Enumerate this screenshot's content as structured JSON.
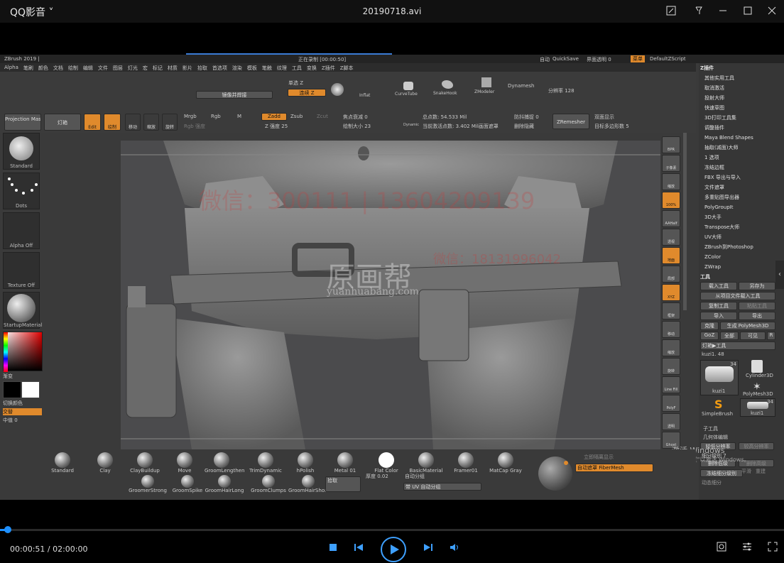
{
  "player": {
    "app_name": "QQ影音",
    "chevron": "˅",
    "file_name": "20190718.avi",
    "time": "00:00:51 / 02:00:00",
    "progress": 0.007
  },
  "zbrush": {
    "title": "ZBrush 2019 |",
    "status_center": "正在录制 [00:00:50]",
    "top_right": [
      "自动",
      "QuickSave",
      "界面透明 0",
      "菜单",
      "DefaultZScript"
    ],
    "menu": [
      "Alpha",
      "笔刷",
      "颜色",
      "文档",
      "绘制",
      "编辑",
      "文件",
      "图层",
      "灯光",
      "宏",
      "标记",
      "材质",
      "影片",
      "拾取",
      "首选项",
      "渲染",
      "模板",
      "笔触",
      "纹理",
      "工具",
      "变换",
      "Z插件",
      "Z脚本"
    ],
    "shelf": {
      "projection": "Projection Master",
      "light": "灯箱",
      "mirror": "镜像并焊接",
      "single_z": "单选 Z",
      "connect_z": "连续 Z",
      "inflat": "Inflat",
      "curvetube": "CurveTube",
      "snakehook": "SnakeHook",
      "zmodeler": "ZModeler",
      "dynamesh": "Dynamesh",
      "resolution": "分辨率 128",
      "edit": "Edit",
      "draw": "绘制",
      "move": "移动",
      "scale": "缩放",
      "rotate": "旋转"
    },
    "ctrl": {
      "mrgb": "Mrgb",
      "rgb": "Rgb",
      "m": "M",
      "zadd": "Zadd",
      "zsub": "Zsub",
      "zcut": "Zcut",
      "rgb_int": "Rgb 强度",
      "z_int": "Z 强度 25",
      "focal": "焦点衰减 0",
      "draw_size": "绘制大小 23",
      "dynamic": "Dynamic",
      "active_pts": "总点数: 54.533 Mil",
      "total_pts": "当前激活点数: 3.402 Mil画面遮罩",
      "backface": "防抖捕捉 0",
      "delete_hidden": "删除隐藏",
      "zremesher": "ZRemesher",
      "double": "双面显示",
      "target_poly": "目标多边形数 5"
    },
    "left": {
      "standard": "Standard",
      "dots": "Dots",
      "alpha_off": "Alpha Off",
      "texture_off": "Texture Off",
      "startup": "StartupMaterial",
      "gradient": "渐变",
      "switch": "切换颜色",
      "alternate": "交替",
      "mid": "中值 0"
    },
    "viewport": {
      "watermark1": "原画帮",
      "watermark2": "yuanhuabang.com",
      "watermark3": "微信：300111 | 13604209139",
      "watermark4": "微信：18131996042"
    },
    "right_tools": [
      "BPR",
      "子像素",
      "缩放",
      "100%",
      "AAHalf",
      "透视",
      "地面",
      "局部",
      "XYZ",
      "框架",
      "移动",
      "缩放",
      "旋转",
      "Line Fill",
      "PolyF",
      "透明",
      "Ghost",
      "固定",
      "Xpose"
    ],
    "zplugin": {
      "header": "Z插件",
      "items": [
        "其他实用工具",
        "取消激活",
        "投射大师",
        "快速草图",
        "3D打印工具集",
        "调整插件",
        "Maya Blend Shapes",
        "抽取(减面)大师",
        "1 选项",
        "冻结边框",
        "FBX 导出与导入",
        "文件遮罩",
        "多重贴图导出器",
        "PolyGroupIt",
        "3D大手",
        "Transpose大师",
        "UV大师",
        "ZBrush到Photoshop",
        "ZColor",
        "ZWrap"
      ]
    },
    "tool": {
      "header": "工具",
      "load": "载入工具",
      "save_as": "另存为",
      "import_project": "从项目文件载入工具",
      "copy": "复制工具",
      "paste": "粘贴工具",
      "import": "导入",
      "export": "导出",
      "clone": "克隆",
      "make_poly": "生成 PolyMesh3D",
      "goz": "GoZ",
      "all": "全部",
      "visible": "可见",
      "r": "R",
      "lightbox": "灯箱▶工具",
      "current": "kuzi1. 48",
      "thumb1": "kuzi1",
      "thumb1_count": "34",
      "cylinder": "Cylinder3D",
      "polymesh": "PolyMesh3D",
      "simplebrush": "SimpleBrush",
      "thumb2": "kuzi1",
      "thumb2_count": "34",
      "subtool": "子工具",
      "geometry": "几何体编辑",
      "lower": "较低分辨率",
      "higher": "较高分辨率",
      "sdiv": "细分级别 7",
      "delete_lower": "删除低级",
      "delete_higher": "删除高级",
      "freeze": "冻结细分级别",
      "dynamic_sub": "动态细分",
      "smooth": "平滑",
      "reconstruct": "重建"
    },
    "activate": {
      "line1": "激活 Windows",
      "line2": "转到\"设置\"以激活 Windows。"
    },
    "bottom": {
      "materials": [
        "Standard",
        "Clay",
        "ClayBuildup",
        "Move",
        "GroomLengthen",
        "TrimDynamic",
        "hPolish",
        "Metal 01",
        "Flat Color",
        "BasicMaterial",
        "Framer01",
        "MatCap Gray"
      ],
      "row2": [
        "GroomerStrong",
        "GroomSpike",
        "GroomHairLong",
        "GroomClumps",
        "GroomHairShort"
      ],
      "pick": "拾取",
      "thickness": "厚度 0.02",
      "auto_group": "自动分组",
      "uv_group": "带 UV 自动分组",
      "mask1": "立即隔离显示",
      "mask2": "自动遮罩 FiberMesh"
    }
  }
}
